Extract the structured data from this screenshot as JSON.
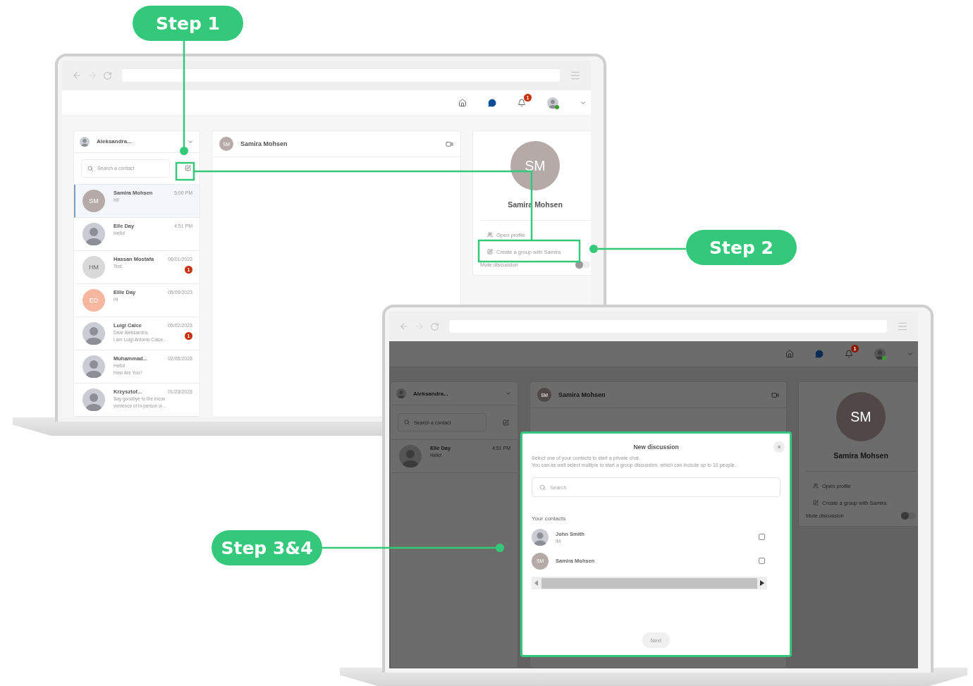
{
  "steps": [
    {
      "label": "Step 1"
    },
    {
      "label": "Step 2"
    },
    {
      "label": "Step 3&4"
    }
  ],
  "laptops": [
    {
      "header": {
        "notification_count": "1"
      },
      "sidebar": {
        "account_name": "Aleksandra...",
        "search": {
          "placeholder": "Search a contact"
        },
        "conversations": [
          {
            "name": "Samira Mohsen",
            "time": "5:00 PM",
            "preview": [
              "Hi!"
            ],
            "avatar": {
              "kind": "initials",
              "initials": "SM",
              "color": "#b5aaa7"
            },
            "selected": true
          },
          {
            "name": "Elle Day",
            "time": "4:51 PM",
            "preview": [
              "Hello!"
            ],
            "avatar": {
              "kind": "photo"
            },
            "selected": false
          },
          {
            "name": "Hassan Mostafa",
            "time": "06/01/2023",
            "preview": [
              "Test"
            ],
            "unread": "1",
            "avatar": {
              "kind": "initials",
              "initials": "HM",
              "color": "#d9d9d9"
            },
            "selected": false
          },
          {
            "name": "Ellle Day",
            "time": "05/09/2023",
            "preview": [
              "Hi"
            ],
            "avatar": {
              "kind": "initials",
              "initials": "ED",
              "color": "#f6b6a0"
            },
            "selected": false
          },
          {
            "name": "Luigi Calce",
            "time": "05/02/2023",
            "preview": [
              "Dear Aleksandra,",
              "I am Luigi Antonio Calce..."
            ],
            "unread": "1",
            "avatar": {
              "kind": "photo"
            },
            "selected": false
          },
          {
            "name": "Muhammad...",
            "time": "02/05/2023",
            "preview": [
              "Hello!",
              "How Are You?"
            ],
            "avatar": {
              "kind": "photo"
            },
            "selected": false
          },
          {
            "name": "Krzysztof...",
            "time": "01/23/2023",
            "preview": [
              "Say goodbye to the incon",
              "venience of in-person vi..."
            ],
            "avatar": {
              "kind": "photo"
            },
            "selected": false
          }
        ]
      },
      "chat": {
        "contact_initials": "SM",
        "contact_name": "Samira Mohsen"
      },
      "profile": {
        "initials": "SM",
        "name": "Samira Mohsen",
        "actions": [
          {
            "kind": "profile",
            "label": "Open profile"
          },
          {
            "kind": "group",
            "label": "Create a group with Samira"
          }
        ],
        "mute": {
          "label": "Mute discussion",
          "on": false
        }
      }
    },
    {
      "header": {
        "notification_count": "1"
      },
      "sidebar": {
        "account_name": "Aleksandra...",
        "search": {
          "placeholder": "Search a contact"
        },
        "conversations": [
          {
            "name": "Elle Day",
            "time": "4:51 PM",
            "preview": [
              "Hello!"
            ],
            "avatar": {
              "kind": "photo"
            },
            "selected": false
          }
        ]
      },
      "chat": {
        "contact_initials": "SM",
        "contact_name": "Samira Mohsen"
      },
      "profile": {
        "initials": "SM",
        "name": "Samira Mohsen",
        "actions": [
          {
            "kind": "profile",
            "label": "Open profile"
          },
          {
            "kind": "group",
            "label": "Create a group with Samira"
          }
        ],
        "mute": {
          "label": "Mute discussion",
          "on": false
        }
      },
      "modal": {
        "title": "New discussion",
        "close": "×",
        "intro": [
          "Select one of your contacts to start a private chat.",
          "You can as well select multiple to start a group discussion, which can include up to 10 people."
        ],
        "search": {
          "placeholder": "Search"
        },
        "section": "Your contacts",
        "contacts": [
          {
            "name": "John Smith",
            "subtitle": "IM",
            "avatar": {
              "kind": "photo"
            },
            "checked": false
          },
          {
            "name": "Samira Mohsen",
            "avatar": {
              "kind": "initials",
              "initials": "SM",
              "color": "#b5aaa7"
            },
            "checked": false
          }
        ],
        "next": {
          "label": "Next",
          "disabled": true
        }
      }
    }
  ]
}
